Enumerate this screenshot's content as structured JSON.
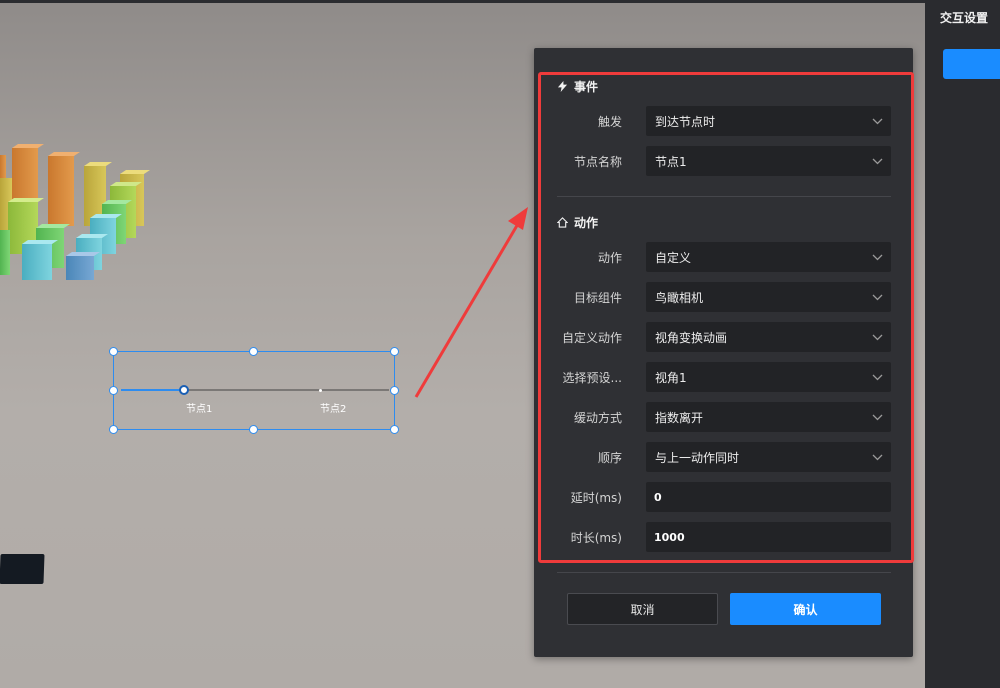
{
  "side_panel": {
    "title": "交互设置"
  },
  "scene": {
    "node_labels": [
      "节点1",
      "节点2"
    ],
    "selected_node_progress": 0.23
  },
  "dialog": {
    "event_section": {
      "title": "事件",
      "icon": "lightning-icon",
      "fields": [
        {
          "label": "触发",
          "value": "到达节点时"
        },
        {
          "label": "节点名称",
          "value": "节点1"
        }
      ]
    },
    "action_section": {
      "title": "动作",
      "icon": "house-icon",
      "selects": [
        {
          "label": "动作",
          "value": "自定义"
        },
        {
          "label": "目标组件",
          "value": "鸟瞰相机"
        },
        {
          "label": "自定义动作",
          "value": "视角变换动画"
        },
        {
          "label": "选择预设...",
          "value": "视角1"
        },
        {
          "label": "缓动方式",
          "value": "指数离开"
        },
        {
          "label": "顺序",
          "value": "与上一动作同时"
        }
      ],
      "inputs": [
        {
          "label": "延时(ms)",
          "value": "0"
        },
        {
          "label": "时长(ms)",
          "value": "1000"
        }
      ]
    },
    "buttons": {
      "cancel": "取消",
      "confirm": "确认"
    }
  },
  "colors": {
    "accent": "#1a8cff",
    "highlight_box": "#ef3b3b",
    "arrow": "#ef3b3b"
  }
}
